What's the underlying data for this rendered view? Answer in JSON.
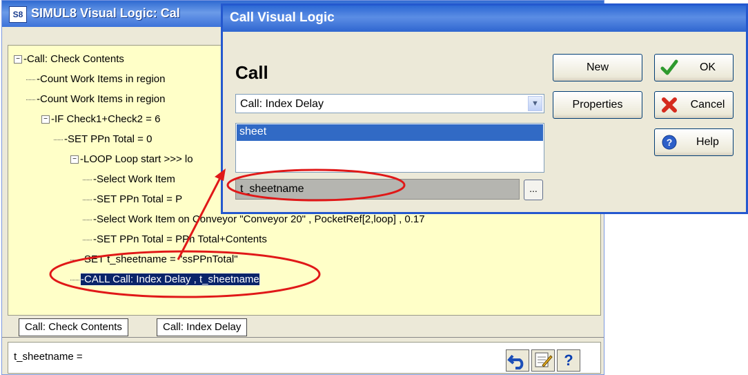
{
  "visual_logic_window": {
    "app_icon_label": "S8",
    "title": "SIMUL8 Visual Logic: Cal",
    "tree": [
      {
        "text": "-Call: Check Contents",
        "expander": "−"
      },
      {
        "text": "-Count Work Items in region",
        "expander": ""
      },
      {
        "text": "-Count Work Items in region",
        "expander": ""
      },
      {
        "text": "-IF Check1+Check2  =  6",
        "expander": "−"
      },
      {
        "text": "-SET PPn Total  =  0",
        "expander": ""
      },
      {
        "text": "-LOOP Loop start >>> lo",
        "expander": "−"
      },
      {
        "text": "-Select Work Item",
        "expander": ""
      },
      {
        "text": "-SET PPn Total  =  P",
        "expander": ""
      },
      {
        "text": "-Select Work Item on Conveyor  \"Conveyor 20\" , PocketRef[2,loop] ,  0.17",
        "expander": ""
      },
      {
        "text": "-SET PPn Total  =  PPn Total+Contents",
        "expander": ""
      },
      {
        "text": "-SET t_sheetname  =  \"ssPPnTotal\"",
        "expander": ""
      },
      {
        "text": "-CALL Call: Index Delay ,  t_sheetname",
        "expander": ""
      }
    ],
    "tabs": [
      "Call: Check Contents",
      "Call: Index Delay"
    ],
    "status_text": "t_sheetname =",
    "help_glyph": "?"
  },
  "call_dialog": {
    "title": "Call Visual Logic",
    "heading": "Call",
    "selected_call": "Call: Index Delay",
    "parameters": [
      "sheet"
    ],
    "parameter_value": "t_sheetname",
    "browse_label": "...",
    "buttons": {
      "new": "New",
      "properties": "Properties",
      "ok": "OK",
      "cancel": "Cancel",
      "help": "Help"
    }
  },
  "colors": {
    "tree_background": "#ffffc8",
    "selection": "#0a246a",
    "annotation": "#e01818",
    "titlebar": "#2c68d4"
  }
}
